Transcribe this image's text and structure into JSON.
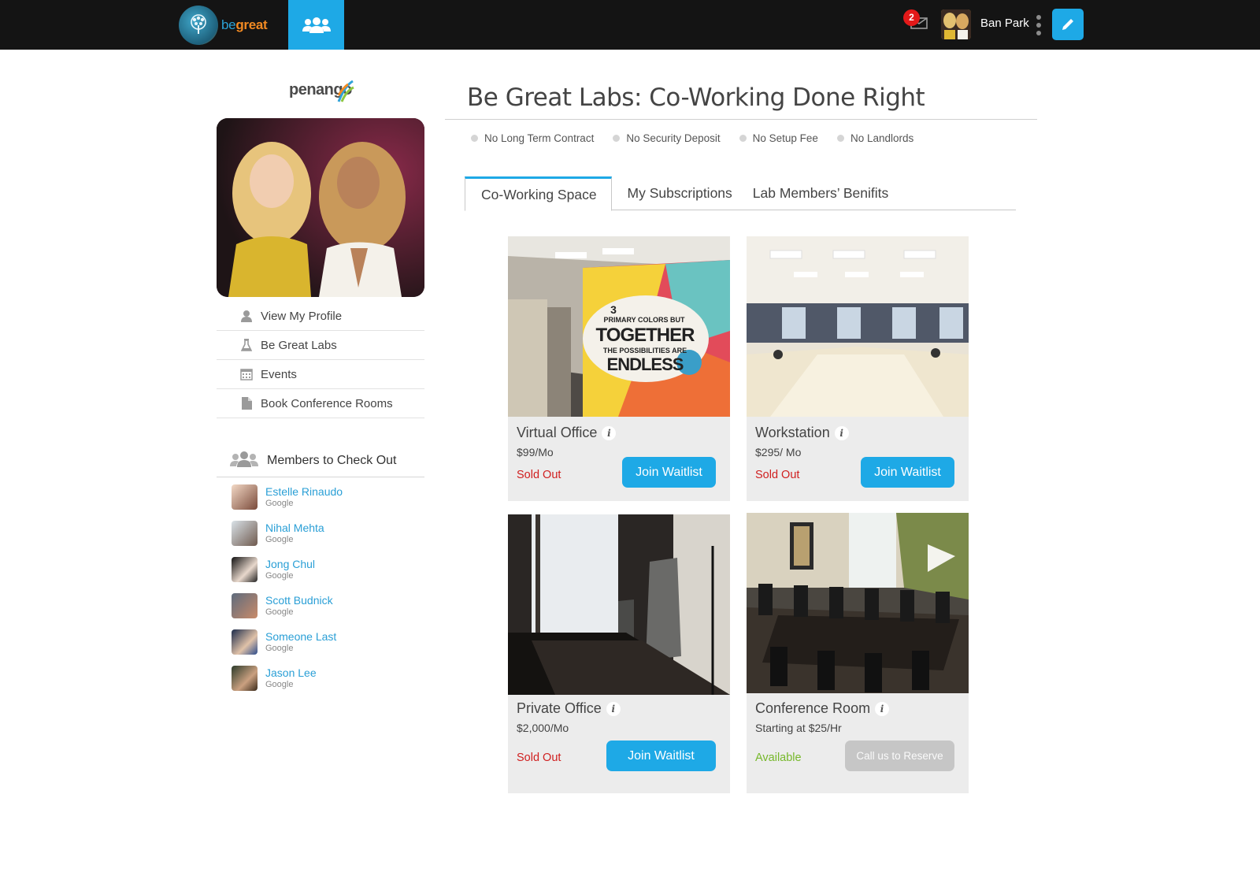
{
  "topbar": {
    "logo_be": "be",
    "logo_great": "great",
    "mail_count": "2",
    "user_name": "Ban Park"
  },
  "sidebar": {
    "brand": "penango",
    "menu": [
      {
        "label": "View My Profile",
        "icon": "person-icon"
      },
      {
        "label": "Be Great Labs",
        "icon": "flask-icon"
      },
      {
        "label": "Events",
        "icon": "calendar-icon"
      },
      {
        "label": "Book Conference Rooms",
        "icon": "document-icon"
      }
    ],
    "members_heading": "Members to Check Out",
    "members": [
      {
        "name": "Estelle Rinaudo",
        "org": "Google"
      },
      {
        "name": "Nihal Mehta",
        "org": "Google"
      },
      {
        "name": "Jong Chul",
        "org": "Google"
      },
      {
        "name": "Scott Budnick",
        "org": "Google"
      },
      {
        "name": "Someone Last",
        "org": "Google"
      },
      {
        "name": "Jason Lee",
        "org": "Google"
      }
    ]
  },
  "main": {
    "title": "Be Great Labs: Co-Working Done Right",
    "features": [
      "No Long Term Contract",
      "No Security Deposit",
      "No Setup Fee",
      "No Landlords"
    ],
    "tabs": [
      {
        "label": "Co-Working Space",
        "active": true
      },
      {
        "label": "My Subscriptions",
        "active": false
      },
      {
        "label": "Lab Members’ Benifits",
        "active": false
      }
    ],
    "cards": [
      {
        "name": "Virtual Office",
        "price": "$99/Mo",
        "status": "Sold Out",
        "button": "Join Waitlist",
        "wall_text": [
          "3",
          "PRIMARY COLORS BUT",
          "TOGETHER",
          "THE POSSIBILITIES ARE",
          "ENDLESS"
        ]
      },
      {
        "name": "Workstation",
        "price": "$295/ Mo",
        "status": "Sold Out",
        "button": "Join Waitlist"
      },
      {
        "name": "Private Office",
        "price": "$2,000/Mo",
        "status": "Sold Out",
        "button": "Join Waitlist"
      },
      {
        "name": "Conference Room",
        "price": "Starting at $25/Hr",
        "status": "Available",
        "button": "Call us to Reserve"
      }
    ],
    "info_glyph": "i"
  },
  "colors": {
    "accent": "#1ea9e6",
    "topbar": "#141414",
    "sold_out": "#d01f1f",
    "available": "#76b82a",
    "link": "#2a9fd6"
  }
}
